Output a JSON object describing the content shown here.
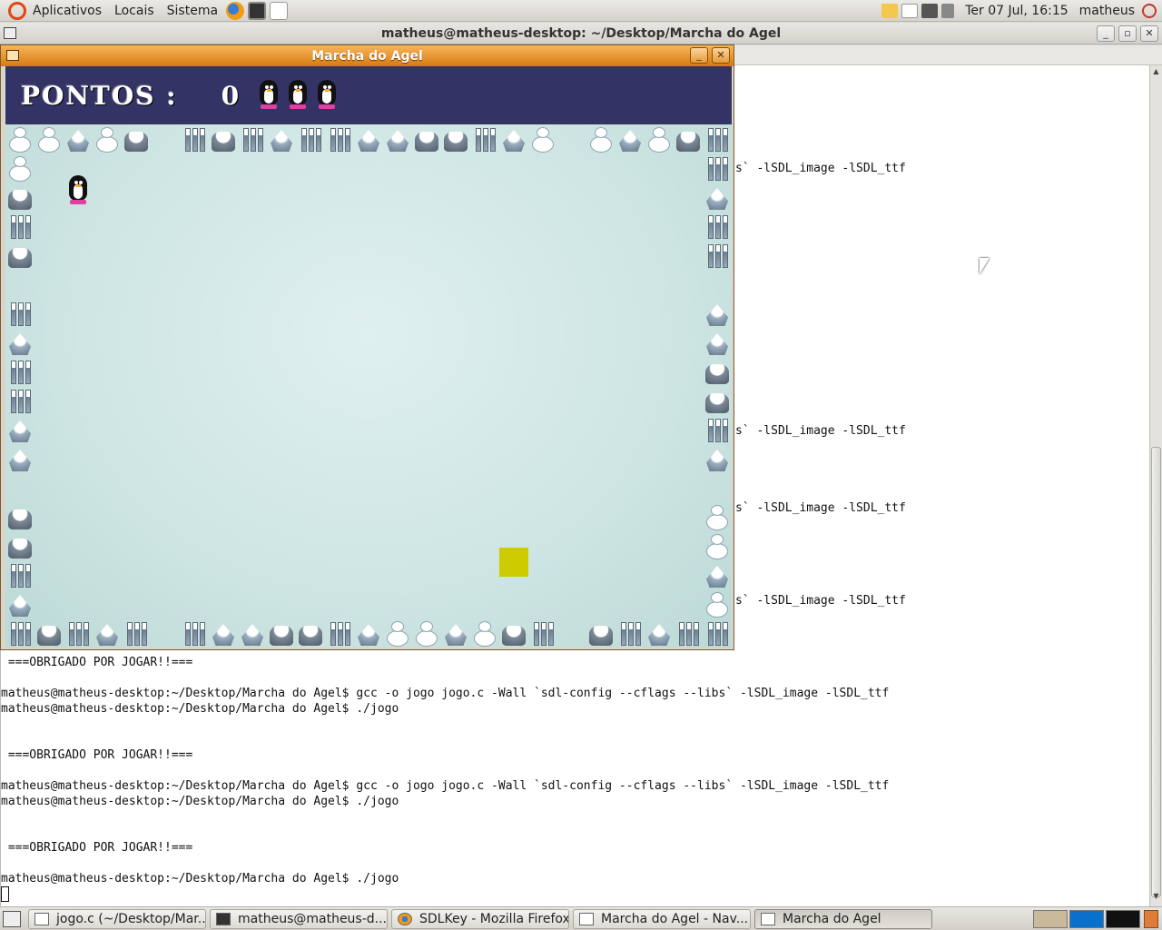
{
  "top_panel": {
    "menus": [
      "Aplicativos",
      "Locais",
      "Sistema"
    ],
    "launchers": [
      "firefox-icon",
      "terminal-icon",
      "text-editor-icon"
    ],
    "clock": "Ter 07 Jul, 16:15",
    "user": "matheus"
  },
  "terminal": {
    "title": "matheus@matheus-desktop: ~/Desktop/Marcha do Agel",
    "visible_line_fragments": [
      "s` -lSDL_image -lSDL_ttf",
      "s` -lSDL_image -lSDL_ttf",
      "s` -lSDL_image -lSDL_ttf",
      "s` -lSDL_image -lSDL_ttf"
    ],
    "lines": [
      " ===OBRIGADO POR JOGAR!!===",
      "",
      "matheus@matheus-desktop:~/Desktop/Marcha do Agel$ gcc -o jogo jogo.c -Wall `sdl-config --cflags --libs` -lSDL_image -lSDL_ttf",
      "matheus@matheus-desktop:~/Desktop/Marcha do Agel$ ./jogo",
      "",
      "",
      " ===OBRIGADO POR JOGAR!!===",
      "",
      "matheus@matheus-desktop:~/Desktop/Marcha do Agel$ gcc -o jogo jogo.c -Wall `sdl-config --cflags --libs` -lSDL_image -lSDL_ttf",
      "matheus@matheus-desktop:~/Desktop/Marcha do Agel$ ./jogo",
      "",
      "",
      " ===OBRIGADO POR JOGAR!!===",
      "",
      "matheus@matheus-desktop:~/Desktop/Marcha do Agel$ ./jogo"
    ]
  },
  "game": {
    "title": "Marcha do Agel",
    "score_label": "PONTOS :",
    "score": "0",
    "lives": 3
  },
  "taskbar": {
    "tasks": [
      {
        "label": "jogo.c (~/Desktop/Mar...",
        "icon": "text-editor-icon",
        "active": false
      },
      {
        "label": "matheus@matheus-d...",
        "icon": "terminal-icon",
        "active": false
      },
      {
        "label": "SDLKey - Mozilla Firefox",
        "icon": "firefox-icon",
        "active": false
      },
      {
        "label": "Marcha do Agel - Nav...",
        "icon": "window-icon",
        "active": false
      },
      {
        "label": "Marcha do Agel",
        "icon": "window-icon",
        "active": true
      }
    ]
  },
  "colors": {
    "hud_background": "#333366",
    "game_titlebar": "#e8921f",
    "target_block": "#cccc00",
    "ice_field": "#d2e8e6"
  }
}
